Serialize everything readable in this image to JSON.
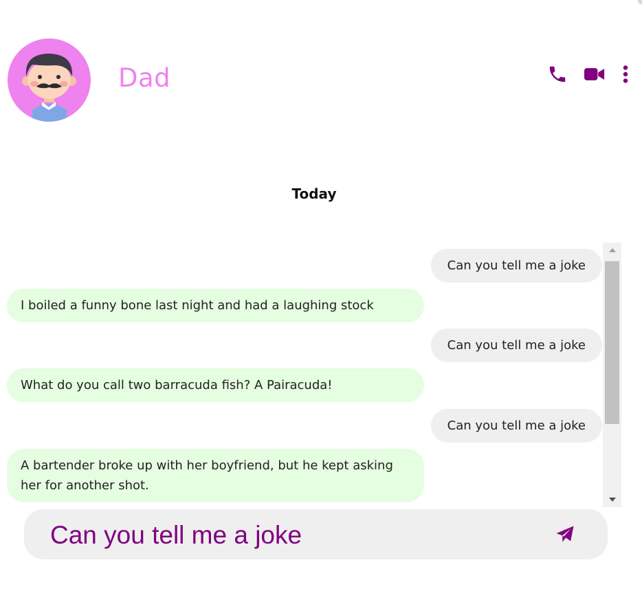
{
  "contact": {
    "name": "Dad",
    "avatar_icon": "dad-avatar-icon"
  },
  "header": {
    "actions": [
      {
        "icon": "phone-icon"
      },
      {
        "icon": "video-camera-icon"
      },
      {
        "icon": "more-options-icon"
      }
    ]
  },
  "chat": {
    "date_label": "Today",
    "messages": [
      {
        "direction": "sent",
        "text": "Can you tell me a joke"
      },
      {
        "direction": "received",
        "text": "I boiled a funny bone last night and had a laughing stock"
      },
      {
        "direction": "sent",
        "text": "Can you tell me a joke"
      },
      {
        "direction": "received",
        "text": "What do you call two barracuda fish? A Pairacuda!"
      },
      {
        "direction": "sent",
        "text": "Can you tell me a joke"
      },
      {
        "direction": "received",
        "text": "A bartender broke up with her boyfriend, but he kept asking her for another shot."
      }
    ]
  },
  "composer": {
    "value": "Can you tell me a joke",
    "send_icon": "send-icon"
  },
  "colors": {
    "accent": "#800080",
    "name_pink": "#ee82ee",
    "sent_bubble": "#efefef",
    "received_bubble": "#e5fde1"
  }
}
